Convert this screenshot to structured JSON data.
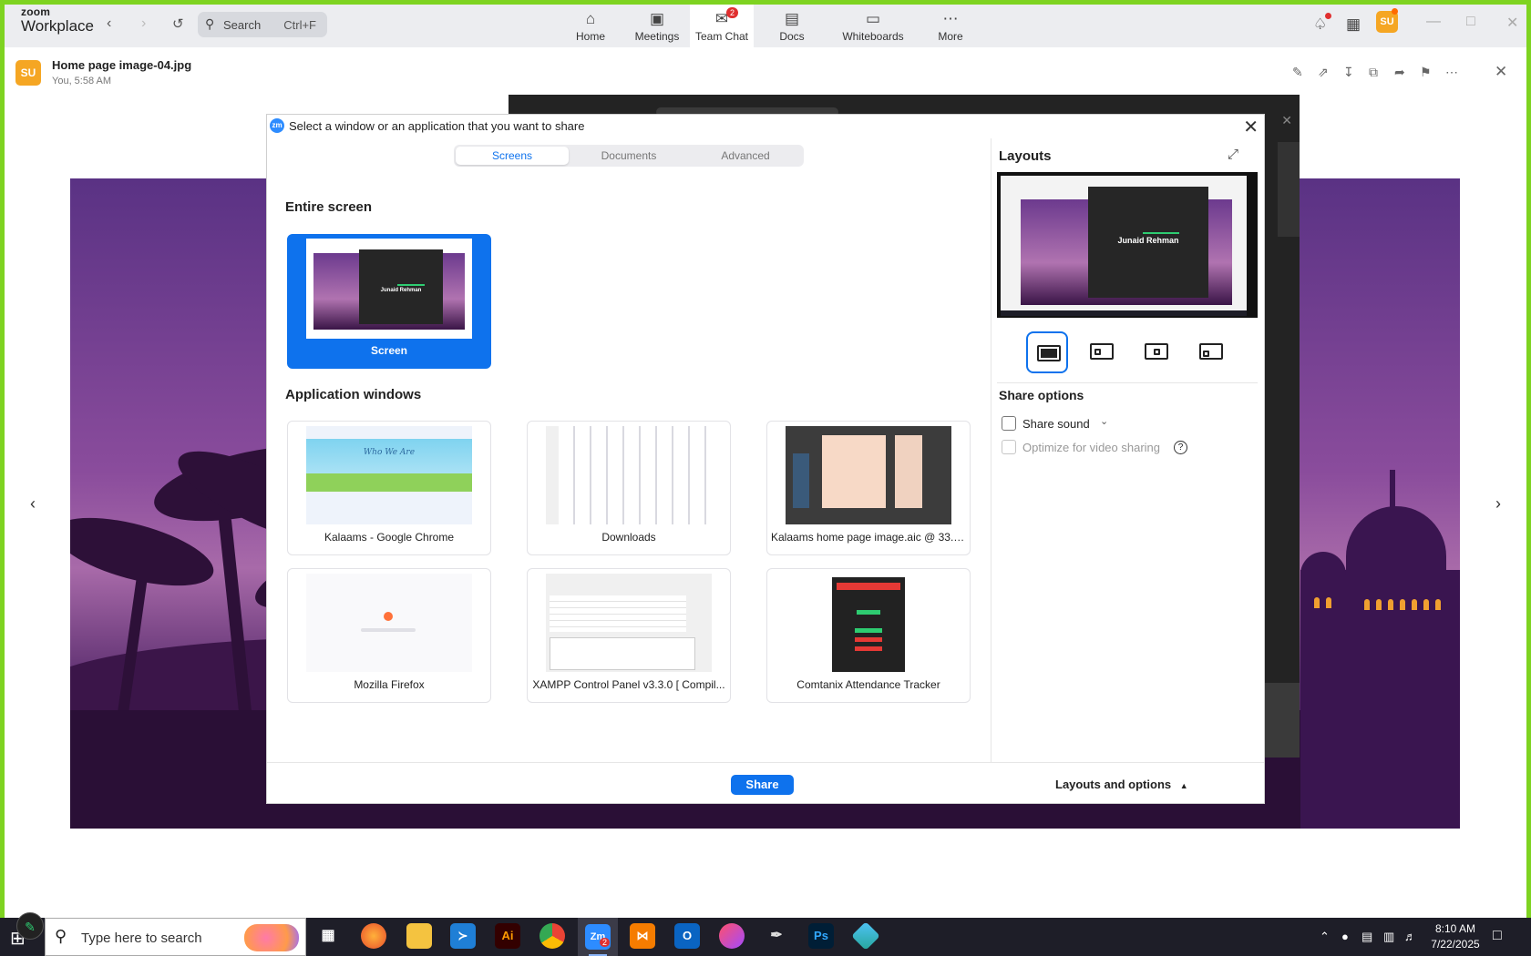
{
  "app": {
    "logo_top": "zoom",
    "logo_bottom": "Workplace",
    "search_label": "Search",
    "search_shortcut": "Ctrl+F",
    "nav": [
      {
        "label": "Home",
        "icon": "home-icon"
      },
      {
        "label": "Meetings",
        "icon": "video-icon"
      },
      {
        "label": "Team Chat",
        "icon": "chat-icon",
        "badge": "2",
        "active": true
      },
      {
        "label": "Docs",
        "icon": "doc-icon"
      },
      {
        "label": "Whiteboards",
        "icon": "whiteboard-icon"
      },
      {
        "label": "More",
        "icon": "ellipsis-icon"
      }
    ],
    "avatar_initials": "SU"
  },
  "file": {
    "avatar": "SU",
    "name": "Home page image-04.jpg",
    "meta": "You, 5:58 AM"
  },
  "dialog": {
    "icon_text": "zm",
    "title": "Select a window or an application that you want to share",
    "tabs": [
      "Screens",
      "Documents",
      "Advanced"
    ],
    "active_tab": "Screens",
    "entire_screen_title": "Entire screen",
    "screen_card_label": "Screen",
    "screen_thumb_name": "Junaid Rehman",
    "app_windows_title": "Application windows",
    "app_windows": [
      {
        "label": "Kalaams - Google Chrome",
        "thumb_heading": "Who We Are"
      },
      {
        "label": "Downloads"
      },
      {
        "label": "Kalaams home page image.aic @ 33.33 ..."
      },
      {
        "label": "Mozilla Firefox"
      },
      {
        "label": "XAMPP Control Panel v3.3.0   [ Compil..."
      },
      {
        "label": "Comtanix Attendance Tracker"
      }
    ],
    "share_button": "Share",
    "layouts_and_options": "Layouts and options",
    "layouts_title": "Layouts",
    "preview_name": "Junaid Rehman",
    "share_options_title": "Share options",
    "options": [
      {
        "label": "Share sound",
        "checked": false,
        "enabled": true
      },
      {
        "label": "Optimize for video sharing",
        "checked": false,
        "enabled": false
      }
    ]
  },
  "taskbar": {
    "search_placeholder": "Type here to search",
    "zoom_badge": "2",
    "time": "8:10 AM",
    "date": "7/22/2025",
    "apps": [
      "task-view",
      "firefox",
      "file-explorer",
      "vscode",
      "illustrator",
      "chrome",
      "zoom",
      "xampp",
      "outlook",
      "creative-cloud",
      "pen-tool",
      "photoshop",
      "app"
    ]
  },
  "colors": {
    "accent": "#0e72ed",
    "frame": "#7ed321",
    "avatar": "#f5a623"
  }
}
